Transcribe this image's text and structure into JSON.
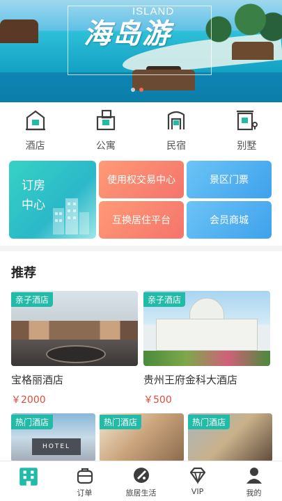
{
  "banner": {
    "island_text": "ISLAND",
    "calligraphy": "海岛游",
    "carousel_dots": 2,
    "active_dot": 1
  },
  "categories": [
    {
      "label": "酒店",
      "icon": "hotel-icon"
    },
    {
      "label": "公寓",
      "icon": "apartment-icon"
    },
    {
      "label": "民宿",
      "icon": "homestay-icon"
    },
    {
      "label": "别墅",
      "icon": "villa-icon"
    }
  ],
  "services": {
    "booking_line1": "订房",
    "booking_line2": "中心",
    "usage_rights": "使用权交易中心",
    "scenic_tickets": "景区门票",
    "home_exchange": "互换居住平台",
    "member_mall": "会员商城"
  },
  "recommend": {
    "title": "推荐",
    "featured": [
      {
        "tag": "亲子酒店",
        "name": "宝格丽酒店",
        "price": "￥2000"
      },
      {
        "tag": "亲子酒店",
        "name": "贵州王府金科大酒店",
        "price": "￥500"
      }
    ],
    "more": [
      {
        "tag": "热门酒店",
        "sign": "HOTEL"
      },
      {
        "tag": "热门酒店"
      },
      {
        "tag": "热门酒店"
      }
    ]
  },
  "tabbar": [
    {
      "label": "",
      "icon": "home-icon",
      "active": true
    },
    {
      "label": "订单",
      "icon": "orders-icon"
    },
    {
      "label": "旅居生活",
      "icon": "travel-life-icon"
    },
    {
      "label": "VIP",
      "icon": "vip-diamond-icon"
    },
    {
      "label": "我的",
      "icon": "profile-icon"
    }
  ],
  "colors": {
    "teal": "#21bba8",
    "orange": "#f4746b",
    "blue": "#3ea1ec",
    "price_red": "#e24a3b",
    "dark_icon": "#3d3d3d"
  }
}
